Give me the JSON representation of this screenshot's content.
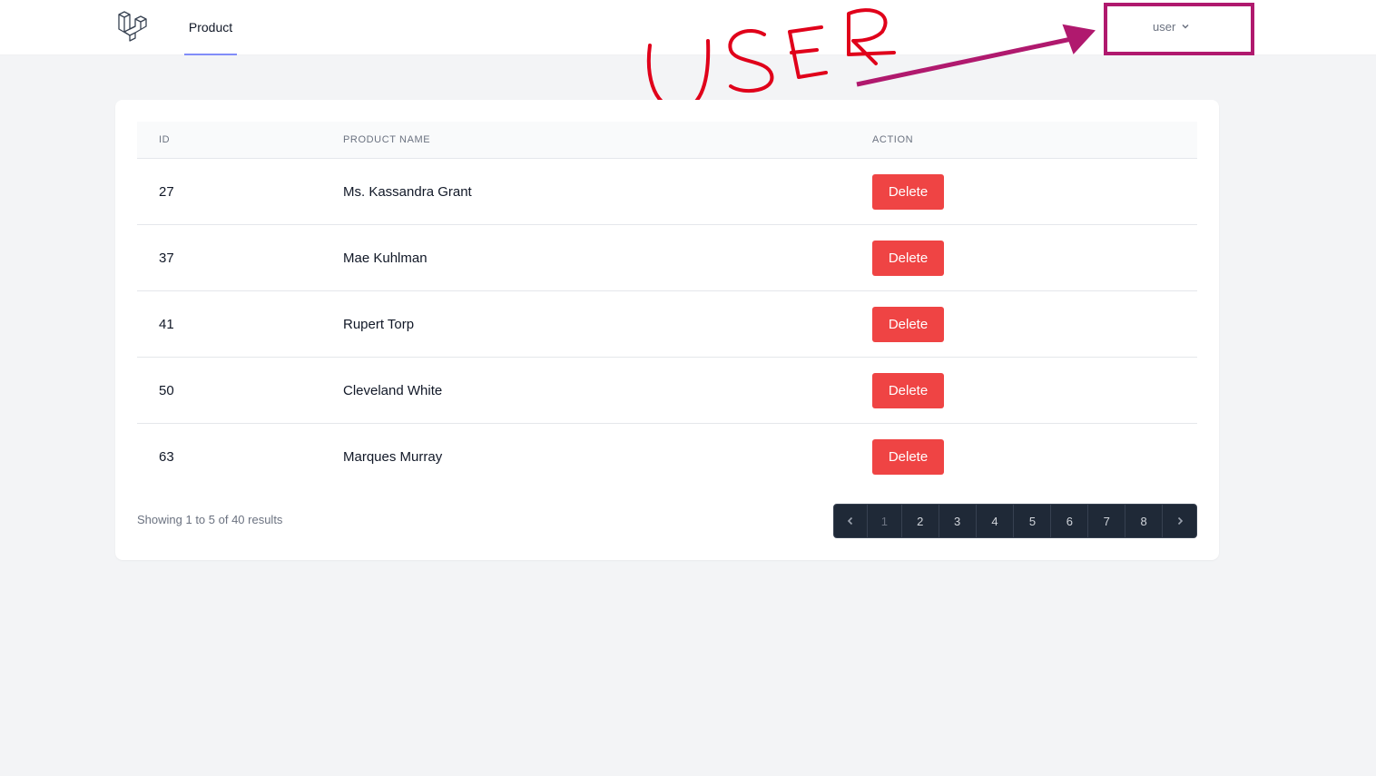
{
  "nav": {
    "logo_icon": "laravel-logo-icon",
    "product_link": "Product",
    "user_menu_label": "user",
    "user_menu_icon": "chevron-down-icon"
  },
  "annotation": {
    "handwritten_text": "USER",
    "color": "#b0196e",
    "text_color": "#e0001a"
  },
  "table": {
    "headers": [
      "ID",
      "PRODUCT NAME",
      "ACTION"
    ],
    "rows": [
      {
        "id": "27",
        "name": "Ms. Kassandra Grant",
        "action": "Delete"
      },
      {
        "id": "37",
        "name": "Mae Kuhlman",
        "action": "Delete"
      },
      {
        "id": "41",
        "name": "Rupert Torp",
        "action": "Delete"
      },
      {
        "id": "50",
        "name": "Cleveland White",
        "action": "Delete"
      },
      {
        "id": "63",
        "name": "Marques Murray",
        "action": "Delete"
      }
    ]
  },
  "pagination": {
    "showing": "Showing 1 to 5 of 40 results",
    "pages": [
      "1",
      "2",
      "3",
      "4",
      "5",
      "6",
      "7",
      "8"
    ],
    "current_page": "1",
    "prev_icon": "chevron-left-icon",
    "next_icon": "chevron-right-icon"
  },
  "colors": {
    "delete_button": "#ef4444",
    "nav_active_underline": "#818cf8",
    "pagination_bg": "#1f2937"
  }
}
